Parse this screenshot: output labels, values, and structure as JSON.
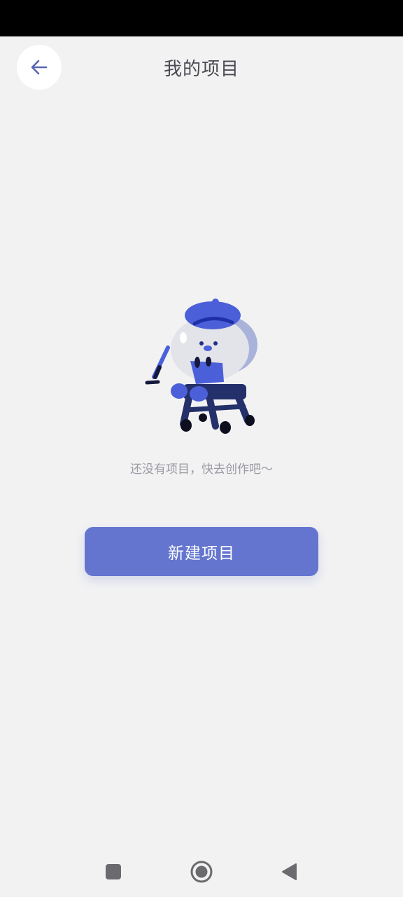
{
  "header": {
    "title": "我的项目",
    "back_icon": "arrow-left-icon"
  },
  "empty_state": {
    "illustration": "artist-character-illustration",
    "message": "还没有项目，快去创作吧～"
  },
  "actions": {
    "create_label": "新建项目"
  },
  "colors": {
    "accent": "#6475cf",
    "background": "#f2f2f3",
    "title": "#4a4a52",
    "muted_text": "#9a9aa2",
    "icon_blue": "#5566b0"
  },
  "system_nav": {
    "recent_icon": "square-recent-icon",
    "home_icon": "circle-home-icon",
    "back_icon": "triangle-back-icon"
  }
}
